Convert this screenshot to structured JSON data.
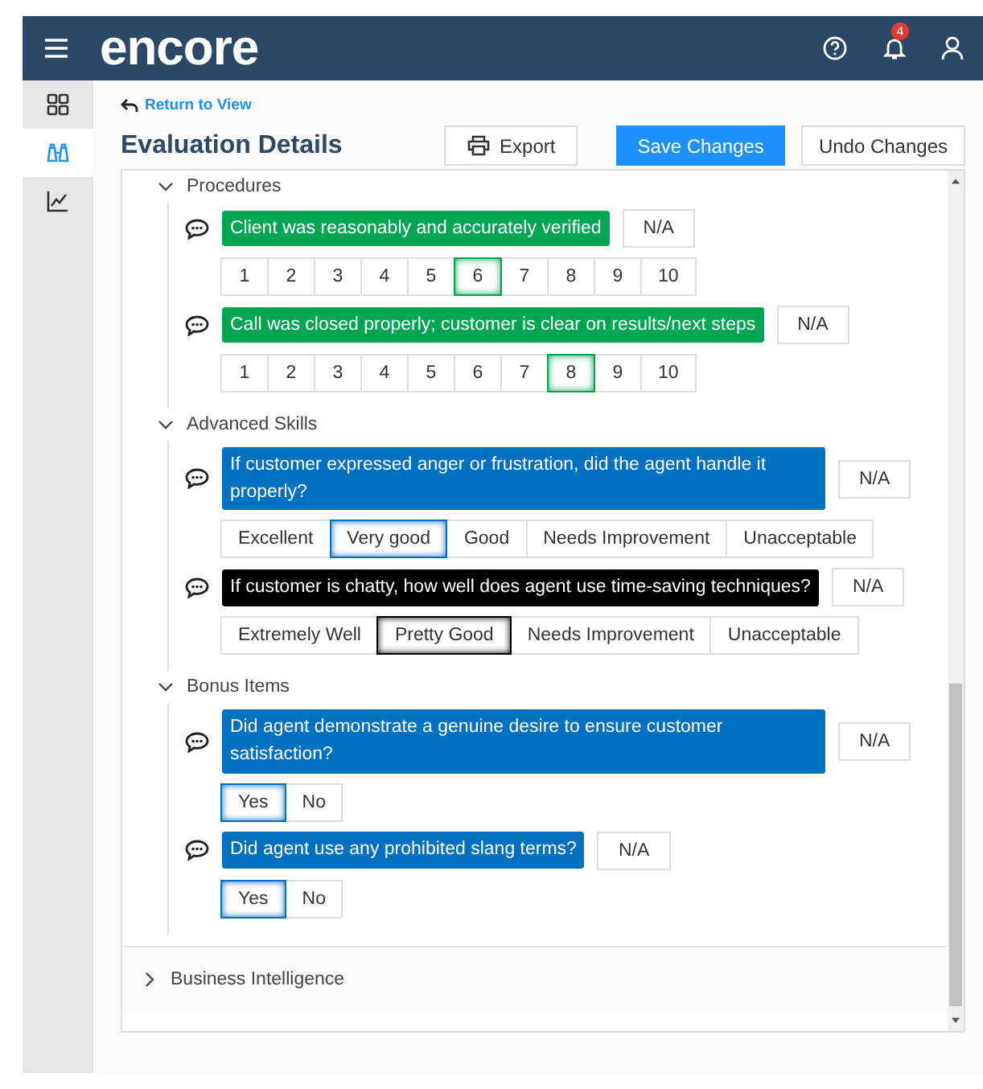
{
  "header": {
    "logo": "encore",
    "notification_count": "4"
  },
  "sidebar": {
    "items": [
      {
        "selected": false
      },
      {
        "selected": true
      },
      {
        "selected": false
      }
    ]
  },
  "back_link": "Return to View",
  "title": "Evaluation Details",
  "buttons": [
    {
      "label": "Export",
      "kind": "export"
    },
    {
      "label": "Save Changes",
      "kind": "primary"
    },
    {
      "label": "Undo Changes",
      "kind": "plain"
    }
  ],
  "sections": [
    {
      "title": "Procedures",
      "expanded": true,
      "questions": [
        {
          "text": "Client was reasonably and accurately verified",
          "color": "#00a651",
          "na": "N/A",
          "options": [
            {
              "label": "1",
              "selected": false
            },
            {
              "label": "2",
              "selected": false
            },
            {
              "label": "3",
              "selected": false
            },
            {
              "label": "4",
              "selected": false
            },
            {
              "label": "5",
              "selected": false
            },
            {
              "label": "6",
              "selected": true
            },
            {
              "label": "7",
              "selected": false
            },
            {
              "label": "8",
              "selected": false
            },
            {
              "label": "9",
              "selected": false
            },
            {
              "label": "10",
              "selected": false
            }
          ]
        },
        {
          "text": "Call was closed properly; customer is clear on results/next steps",
          "color": "#00a651",
          "na": "N/A",
          "options": [
            {
              "label": "1",
              "selected": false
            },
            {
              "label": "2",
              "selected": false
            },
            {
              "label": "3",
              "selected": false
            },
            {
              "label": "4",
              "selected": false
            },
            {
              "label": "5",
              "selected": false
            },
            {
              "label": "6",
              "selected": false
            },
            {
              "label": "7",
              "selected": false
            },
            {
              "label": "8",
              "selected": true
            },
            {
              "label": "9",
              "selected": false
            },
            {
              "label": "10",
              "selected": false
            }
          ]
        }
      ]
    },
    {
      "title": "Advanced Skills",
      "expanded": true,
      "questions": [
        {
          "text": "If customer expressed anger or frustration, did the agent handle it properly?",
          "color": "#0070c0",
          "na": "N/A",
          "options": [
            {
              "label": "Excellent",
              "selected": false
            },
            {
              "label": "Very good",
              "selected": true
            },
            {
              "label": "Good",
              "selected": false
            },
            {
              "label": "Needs Improvement",
              "selected": false
            },
            {
              "label": "Unacceptable",
              "selected": false
            }
          ]
        },
        {
          "text": "If customer is chatty, how well does agent use time-saving techniques?",
          "color": "#000000",
          "na": "N/A",
          "options": [
            {
              "label": "Extremely Well",
              "selected": false
            },
            {
              "label": "Pretty Good",
              "selected": true
            },
            {
              "label": "Needs Improvement",
              "selected": false
            },
            {
              "label": "Unacceptable",
              "selected": false
            }
          ]
        }
      ]
    },
    {
      "title": "Bonus Items",
      "expanded": true,
      "questions": [
        {
          "text": "Did agent demonstrate a genuine desire to ensure customer satisfaction?",
          "color": "#0070c0",
          "na": "N/A",
          "options": [
            {
              "label": "Yes",
              "selected": true
            },
            {
              "label": "No",
              "selected": false
            }
          ]
        },
        {
          "text": "Did agent use any prohibited slang terms?",
          "color": "#0070c0",
          "na": "N/A",
          "options": [
            {
              "label": "Yes",
              "selected": true
            },
            {
              "label": "No",
              "selected": false
            }
          ]
        }
      ]
    },
    {
      "title": "Business Intelligence",
      "expanded": false
    }
  ]
}
